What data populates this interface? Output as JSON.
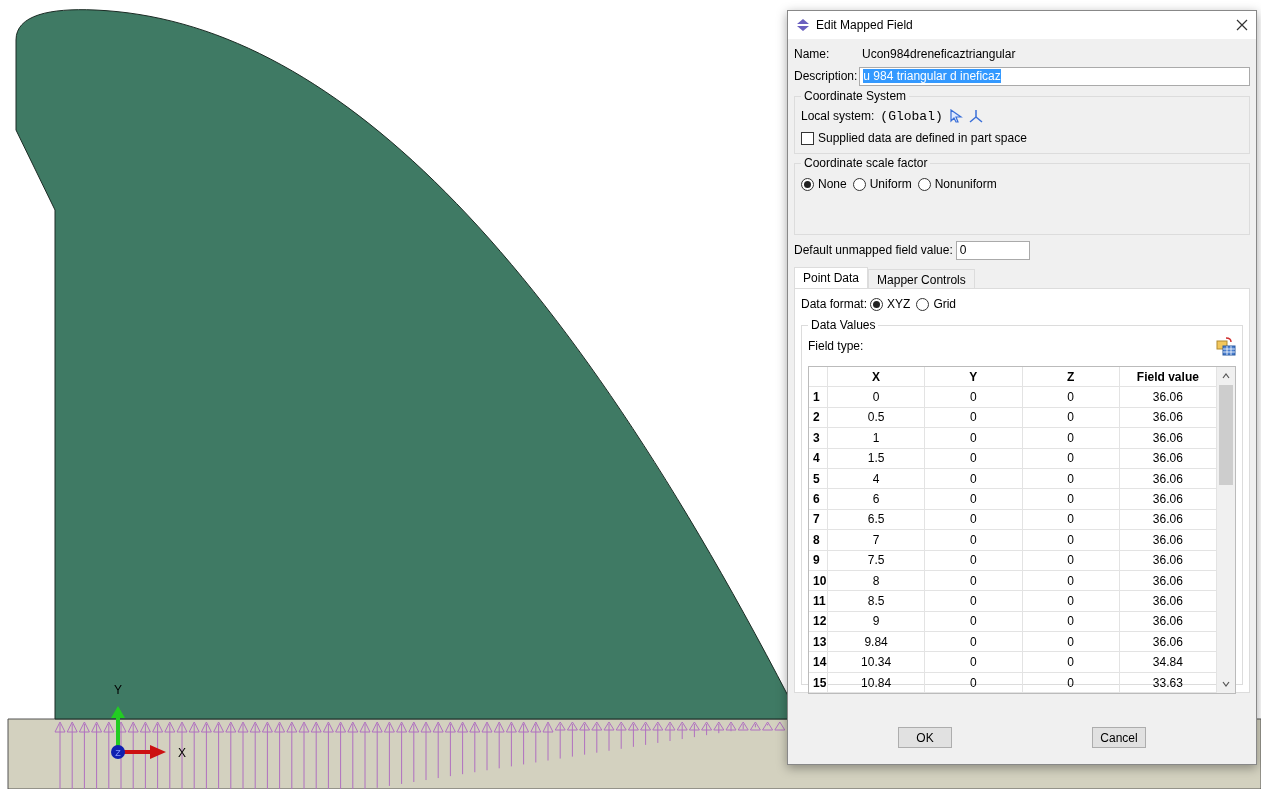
{
  "viewport": {
    "triad": {
      "x_label": "X",
      "y_label": "Y",
      "z_label": "Z"
    }
  },
  "window": {
    "title": "Edit Mapped Field"
  },
  "name": {
    "label": "Name:",
    "value": "Ucon984dreneficaztriangular"
  },
  "description": {
    "label": "Description:",
    "value": "u 984 triangular d ineficaz",
    "text_selected": true
  },
  "coordinate_system": {
    "title": "Coordinate System",
    "local_system_label": "Local system:",
    "local_system_value": "(Global)",
    "supplied_in_part_space": {
      "label": "Supplied data are defined in part space",
      "checked": false
    }
  },
  "scale_factor": {
    "title": "Coordinate scale factor",
    "options": [
      {
        "label": "None",
        "selected": true
      },
      {
        "label": "Uniform",
        "selected": false
      },
      {
        "label": "Nonuniform",
        "selected": false
      }
    ]
  },
  "default_value": {
    "label": "Default unmapped field value:",
    "value": "0"
  },
  "tabs": [
    {
      "label": "Point Data",
      "selected": true
    },
    {
      "label": "Mapper Controls",
      "selected": false
    }
  ],
  "data_format": {
    "label": "Data format:",
    "options": [
      {
        "label": "XYZ",
        "selected": true
      },
      {
        "label": "Grid",
        "selected": false
      }
    ]
  },
  "data_values": {
    "title": "Data Values",
    "field_type_label": "Field type:",
    "table": {
      "columns": [
        "X",
        "Y",
        "Z",
        "Field value"
      ],
      "rows": [
        {
          "index": "1",
          "cells": [
            "0",
            "0",
            "0",
            "36.06"
          ]
        },
        {
          "index": "2",
          "cells": [
            "0.5",
            "0",
            "0",
            "36.06"
          ]
        },
        {
          "index": "3",
          "cells": [
            "1",
            "0",
            "0",
            "36.06"
          ]
        },
        {
          "index": "4",
          "cells": [
            "1.5",
            "0",
            "0",
            "36.06"
          ]
        },
        {
          "index": "5",
          "cells": [
            "4",
            "0",
            "0",
            "36.06"
          ]
        },
        {
          "index": "6",
          "cells": [
            "6",
            "0",
            "0",
            "36.06"
          ]
        },
        {
          "index": "7",
          "cells": [
            "6.5",
            "0",
            "0",
            "36.06"
          ]
        },
        {
          "index": "8",
          "cells": [
            "7",
            "0",
            "0",
            "36.06"
          ]
        },
        {
          "index": "9",
          "cells": [
            "7.5",
            "0",
            "0",
            "36.06"
          ]
        },
        {
          "index": "10",
          "cells": [
            "8",
            "0",
            "0",
            "36.06"
          ]
        },
        {
          "index": "11",
          "cells": [
            "8.5",
            "0",
            "0",
            "36.06"
          ]
        },
        {
          "index": "12",
          "cells": [
            "9",
            "0",
            "0",
            "36.06"
          ]
        },
        {
          "index": "13",
          "cells": [
            "9.84",
            "0",
            "0",
            "36.06"
          ]
        },
        {
          "index": "14",
          "cells": [
            "10.34",
            "0",
            "0",
            "34.84"
          ]
        },
        {
          "index": "15",
          "cells": [
            "10.84",
            "0",
            "0",
            "33.63"
          ]
        }
      ]
    }
  },
  "buttons": [
    {
      "label": "OK"
    },
    {
      "label": "Cancel"
    }
  ]
}
